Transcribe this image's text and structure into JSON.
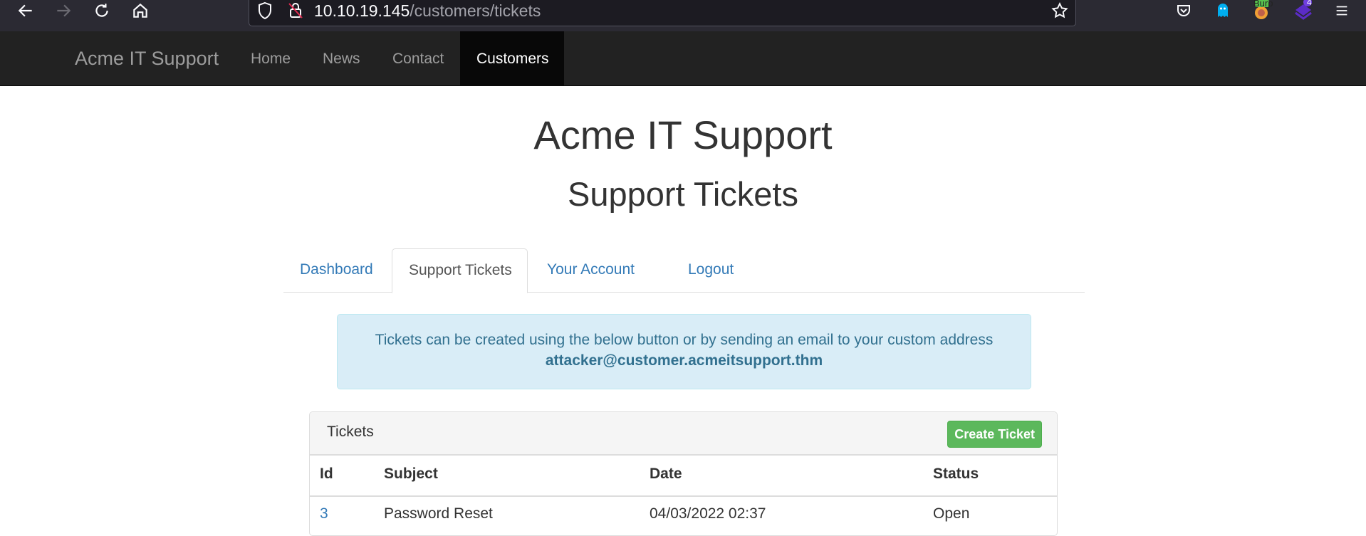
{
  "browser": {
    "url_host": "10.10.19.145",
    "url_path": "/customers/tickets",
    "extensions": [
      {
        "name": "pocket-icon"
      },
      {
        "name": "ghostery-icon"
      },
      {
        "name": "burp-icon",
        "badge": "Burp"
      },
      {
        "name": "extension-icon",
        "badge": "4"
      }
    ]
  },
  "site_nav": {
    "brand": "Acme IT Support",
    "links": [
      "Home",
      "News",
      "Contact",
      "Customers"
    ],
    "active": "Customers"
  },
  "page": {
    "title": "Acme IT Support",
    "subtitle": "Support Tickets"
  },
  "tabs": {
    "items": [
      "Dashboard",
      "Support Tickets",
      "Your Account",
      "Logout"
    ],
    "active": "Support Tickets"
  },
  "alert": {
    "text": "Tickets can be created using the below button or by sending an email to your custom address",
    "email": "attacker@customer.acmeitsupport.thm"
  },
  "tickets": {
    "title": "Tickets",
    "create_label": "Create Ticket",
    "columns": [
      "Id",
      "Subject",
      "Date",
      "Status"
    ],
    "rows": [
      {
        "id": "3",
        "subject": "Password Reset",
        "date": "04/03/2022 02:37",
        "status": "Open"
      }
    ]
  },
  "colors": {
    "navbar": "#222222",
    "link": "#337ab7",
    "alert_bg": "#d9edf7",
    "button_success": "#5cb85c"
  }
}
